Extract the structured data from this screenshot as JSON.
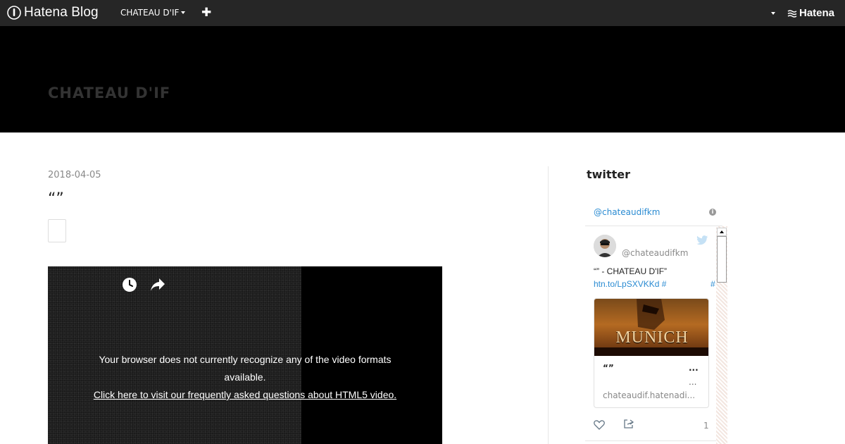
{
  "topbar": {
    "brand": "Hatena Blog",
    "blog_menu_label": "CHATEAU D'IF",
    "add_label": "✚",
    "hatena_label": "Hatena"
  },
  "header": {
    "title_jp": "",
    "title": "CHATEAU D'IF"
  },
  "post": {
    "date": "2018-04-05",
    "title": "“”"
  },
  "video": {
    "message": "Your browser does not currently recognize any of the video formats available.",
    "link": "Click here to visit our frequently asked questions about HTML5 video."
  },
  "sidebar": {
    "heading": "twitter",
    "widget": {
      "handle": "@chateaudifkm",
      "info": "i",
      "tweet": {
        "handle": "@chateaudifkm",
        "text_prefix": "“” - CHATEAU D'IF”",
        "link": "htn.to/LpSXVKKd",
        "hash1": "#",
        "hash2": "#",
        "card": {
          "image_title": "MUNICH",
          "title": "“”",
          "ellipsis1": "...",
          "ellipsis2": "...",
          "domain": "chateaudif.hatenadi..."
        },
        "like_count": "1"
      }
    }
  },
  "colors": {
    "topbar": "#262626",
    "header": "#000000",
    "link": "#2a8bd2"
  }
}
